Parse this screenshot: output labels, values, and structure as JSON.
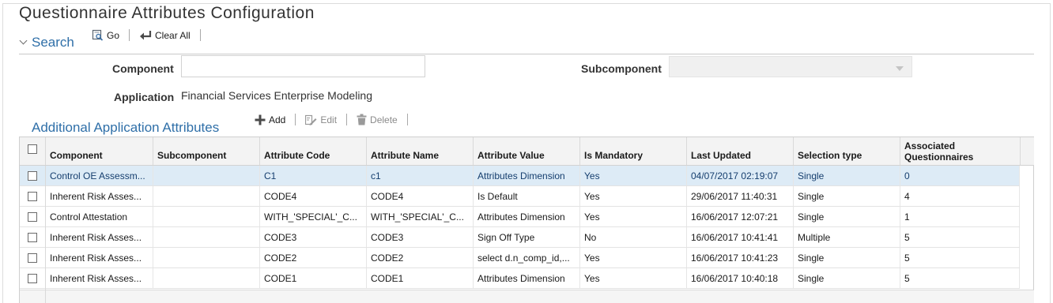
{
  "page": {
    "title": "Questionnaire Attributes Configuration"
  },
  "search": {
    "label": "Search",
    "go_label": "Go",
    "clear_all_label": "Clear All",
    "component_label": "Component",
    "component_value": "",
    "subcomponent_label": "Subcomponent",
    "subcomponent_value": "",
    "application_label": "Application",
    "application_value": "Financial Services Enterprise Modeling"
  },
  "attributes": {
    "title": "Additional Application Attributes",
    "add_label": "Add",
    "edit_label": "Edit",
    "delete_label": "Delete",
    "columns": [
      "Component",
      "Subcomponent",
      "Attribute Code",
      "Attribute Name",
      "Attribute Value",
      "Is Mandatory",
      "Last Updated",
      "Selection type",
      "Associated Questionnaires"
    ],
    "rows": [
      {
        "component": "Control OE Assessm...",
        "subcomponent": "",
        "code": "C1",
        "name": "c1",
        "value": "Attributes Dimension",
        "mandatory": "Yes",
        "updated": "04/07/2017 02:19:07",
        "selection": "Single",
        "questionnaires": "0"
      },
      {
        "component": "Inherent Risk Asses...",
        "subcomponent": "",
        "code": "CODE4",
        "name": "CODE4",
        "value": "Is Default",
        "mandatory": "Yes",
        "updated": "29/06/2017 11:40:31",
        "selection": "Single",
        "questionnaires": "4"
      },
      {
        "component": "Control Attestation",
        "subcomponent": "",
        "code": "WITH_'SPECIAL'_C...",
        "name": "WITH_'SPECIAL'_C...",
        "value": "Attributes Dimension",
        "mandatory": "Yes",
        "updated": "16/06/2017 12:07:21",
        "selection": "Single",
        "questionnaires": "1"
      },
      {
        "component": "Inherent Risk Asses...",
        "subcomponent": "",
        "code": "CODE3",
        "name": "CODE3",
        "value": "Sign Off Type",
        "mandatory": "No",
        "updated": "16/06/2017 10:41:41",
        "selection": "Multiple",
        "questionnaires": "5"
      },
      {
        "component": "Inherent Risk Asses...",
        "subcomponent": "",
        "code": "CODE2",
        "name": "CODE2",
        "value": "select d.n_comp_id,...",
        "mandatory": "Yes",
        "updated": "16/06/2017 10:41:23",
        "selection": "Single",
        "questionnaires": "5"
      },
      {
        "component": "Inherent Risk Asses...",
        "subcomponent": "",
        "code": "CODE1",
        "name": "CODE1",
        "value": "Attributes Dimension",
        "mandatory": "Yes",
        "updated": "16/06/2017 10:40:18",
        "selection": "Single",
        "questionnaires": "5"
      }
    ]
  },
  "colors": {
    "accent": "#2f6fa8",
    "selected_row": "#ddebf6",
    "header_bg": "#f3f3f3"
  },
  "icons": {
    "go": "search-go-icon",
    "clear": "undo-arrow-icon",
    "add": "plus-icon",
    "edit": "pencil-edit-icon",
    "delete": "trash-icon",
    "collapse": "chevron-down-icon",
    "dropdown": "caret-down-icon"
  }
}
